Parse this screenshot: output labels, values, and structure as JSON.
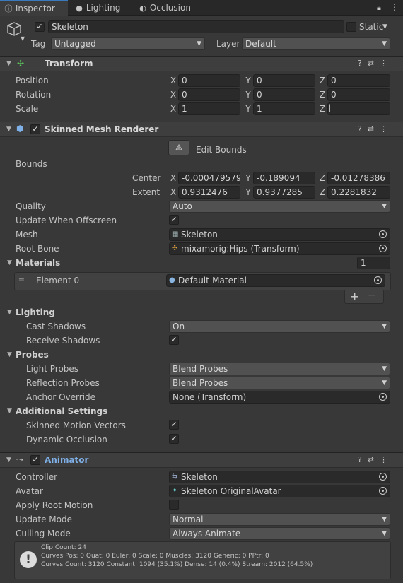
{
  "tabs": [
    {
      "label": "Inspector",
      "icon": "info-icon"
    },
    {
      "label": "Lighting",
      "icon": "bulb-icon"
    },
    {
      "label": "Occlusion",
      "icon": "occlusion-icon"
    }
  ],
  "object": {
    "name": "Skeleton",
    "static_label": "Static",
    "tag_label": "Tag",
    "tag_value": "Untagged",
    "layer_label": "Layer",
    "layer_value": "Default"
  },
  "transform": {
    "title": "Transform",
    "position": {
      "label": "Position",
      "x": "0",
      "y": "0",
      "z": "0"
    },
    "rotation": {
      "label": "Rotation",
      "x": "0",
      "y": "0",
      "z": "0"
    },
    "scale": {
      "label": "Scale",
      "x": "1",
      "y": "1",
      "z": ""
    }
  },
  "axes": {
    "x": "X",
    "y": "Y",
    "z": "Z"
  },
  "smr": {
    "title": "Skinned Mesh Renderer",
    "edit_bounds": "Edit Bounds",
    "bounds_label": "Bounds",
    "center_label": "Center",
    "center": {
      "x": "-0.000479579",
      "y": "-0.189094",
      "z": "-0.01278386"
    },
    "extent_label": "Extent",
    "extent": {
      "x": "0.9312476",
      "y": "0.9377285",
      "z": "0.2281832"
    },
    "quality_label": "Quality",
    "quality_value": "Auto",
    "offscreen_label": "Update When Offscreen",
    "mesh_label": "Mesh",
    "mesh_value": "Skeleton",
    "rootbone_label": "Root Bone",
    "rootbone_value": "mixamorig:Hips (Transform)",
    "materials_label": "Materials",
    "materials_count": "1",
    "element0_label": "Element 0",
    "element0_value": "Default-Material",
    "add": "+",
    "remove": "−",
    "lighting_label": "Lighting",
    "cast_label": "Cast Shadows",
    "cast_value": "On",
    "receive_label": "Receive Shadows",
    "probes_label": "Probes",
    "light_probes_label": "Light Probes",
    "light_probes_value": "Blend Probes",
    "refl_probes_label": "Reflection Probes",
    "refl_probes_value": "Blend Probes",
    "anchor_label": "Anchor Override",
    "anchor_value": "None (Transform)",
    "additional_label": "Additional Settings",
    "motion_label": "Skinned Motion Vectors",
    "dynocc_label": "Dynamic Occlusion"
  },
  "animator": {
    "title": "Animator",
    "controller_label": "Controller",
    "controller_value": "Skeleton",
    "avatar_label": "Avatar",
    "avatar_value": "Skeleton OriginalAvatar",
    "rootmotion_label": "Apply Root Motion",
    "update_label": "Update Mode",
    "update_value": "Normal",
    "culling_label": "Culling Mode",
    "culling_value": "Always Animate",
    "info_line1": "Clip Count: 24",
    "info_line2": "Curves Pos: 0 Quat: 0 Euler: 0 Scale: 0 Muscles: 3120 Generic: 0 PPtr: 0",
    "info_line3": "Curves Count: 3120 Constant: 1094 (35.1%) Dense: 14 (0.4%) Stream: 2012 (64.5%)"
  },
  "colors": {
    "accent": "#3a79bb",
    "animator_title": "#7fb0e8",
    "background": "#383838"
  }
}
